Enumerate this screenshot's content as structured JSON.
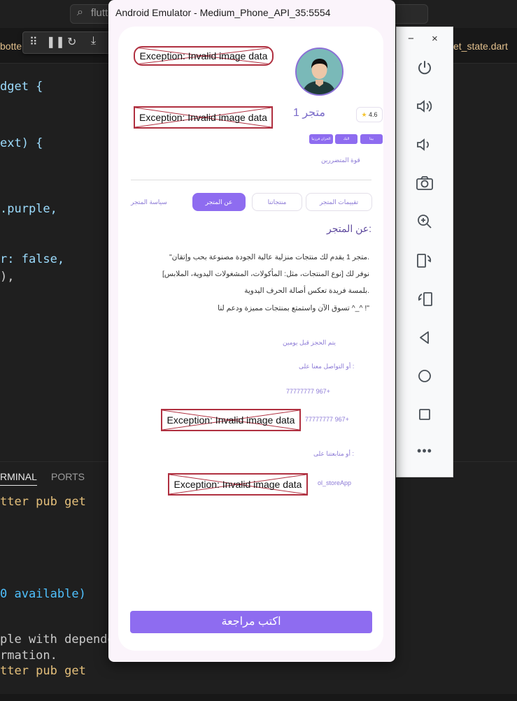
{
  "vscode": {
    "search_text": "flutt",
    "tab_left": "botte",
    "tab_right": "et_state.dart",
    "code_lines": [
      "dget {",
      "ext) {",
      ".purple,",
      "r: false,",
      "),"
    ],
    "panel_tabs": [
      "RMINAL",
      "PORTS"
    ],
    "terminal_lines": [
      "tter pub get",
      "0 available)",
      "ple with dependenc",
      "rmation.",
      "tter pub get"
    ]
  },
  "emulator": {
    "title": "Android Emulator - Medium_Phone_API_35:5554",
    "side_controls": [
      "power-icon",
      "volume-up-icon",
      "volume-down-icon",
      "camera-icon",
      "zoom-icon",
      "rotate-left-icon",
      "rotate-right-icon",
      "back-icon",
      "home-icon",
      "overview-icon",
      "more-icon"
    ],
    "minimize": "−",
    "close": "×"
  },
  "app": {
    "image_error": "Exception: Invalid image data",
    "store_name": "متجر 1",
    "rating": "4.6",
    "mini_buttons": [
      "بيتا",
      "البك",
      "الخزان فرزنيا"
    ],
    "followers": "قوة المتضررين",
    "tabs": [
      "تقييمات المتجر",
      "منتجاتنا",
      "عن المتجر",
      "سياسة المتجر"
    ],
    "about_title": ":عن المتجر",
    "about_lines": [
      ".متجر 1 يقدم لك منتجات منزلية عالية الجودة مصنوعة بحب وإتقان\"",
      "نوفر لك [نوع المنتجات، مثل: المأكولات، المشغولات اليدوية، الملابس]",
      ".بلمسة فريدة تعكس أصالة الحرف اليدوية",
      "\"! ^_^ تسوق الآن واستمتع بمنتجات مميزة ودعم لنا"
    ],
    "booking_note": "يتم الحجز قبل يومين",
    "contact_label": ": أو التواصل معنا على",
    "phone1": "+967 77777777",
    "phone2": "+967 77777777",
    "follow_label": ": أو متابعتنا على",
    "social_handle": "ol_storeApp",
    "review_button": "اكتب مراجعة"
  }
}
